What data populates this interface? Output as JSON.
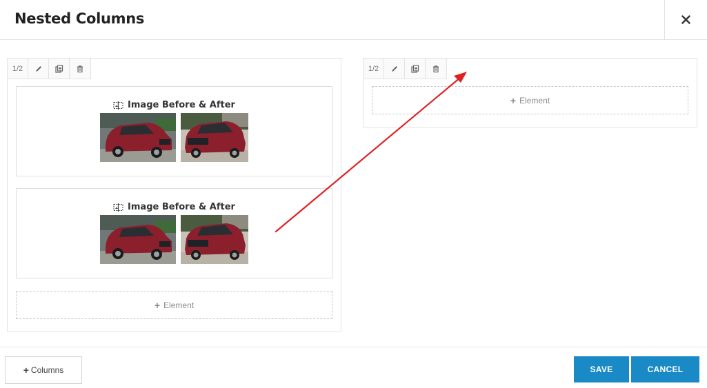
{
  "modal": {
    "title": "Nested Columns",
    "close_icon": "close-icon"
  },
  "columns": [
    {
      "size_label": "1/2",
      "toolbar_icons": [
        "pencil-icon",
        "duplicate-icon",
        "trash-icon"
      ],
      "elements": [
        {
          "title": "Image Before & After",
          "icon": "before-after-icon"
        },
        {
          "title": "Image Before & After",
          "icon": "before-after-icon"
        }
      ],
      "add_label": "Element"
    },
    {
      "size_label": "1/2",
      "toolbar_icons": [
        "pencil-icon",
        "duplicate-icon",
        "trash-icon"
      ],
      "elements": [],
      "add_label": "Element"
    }
  ],
  "footer": {
    "add_columns_label": "Columns",
    "save_label": "SAVE",
    "cancel_label": "CANCEL"
  },
  "colors": {
    "primary_button": "#1a8ac6",
    "annotation_arrow": "#e02020",
    "car_body": "#8c1f2c"
  }
}
